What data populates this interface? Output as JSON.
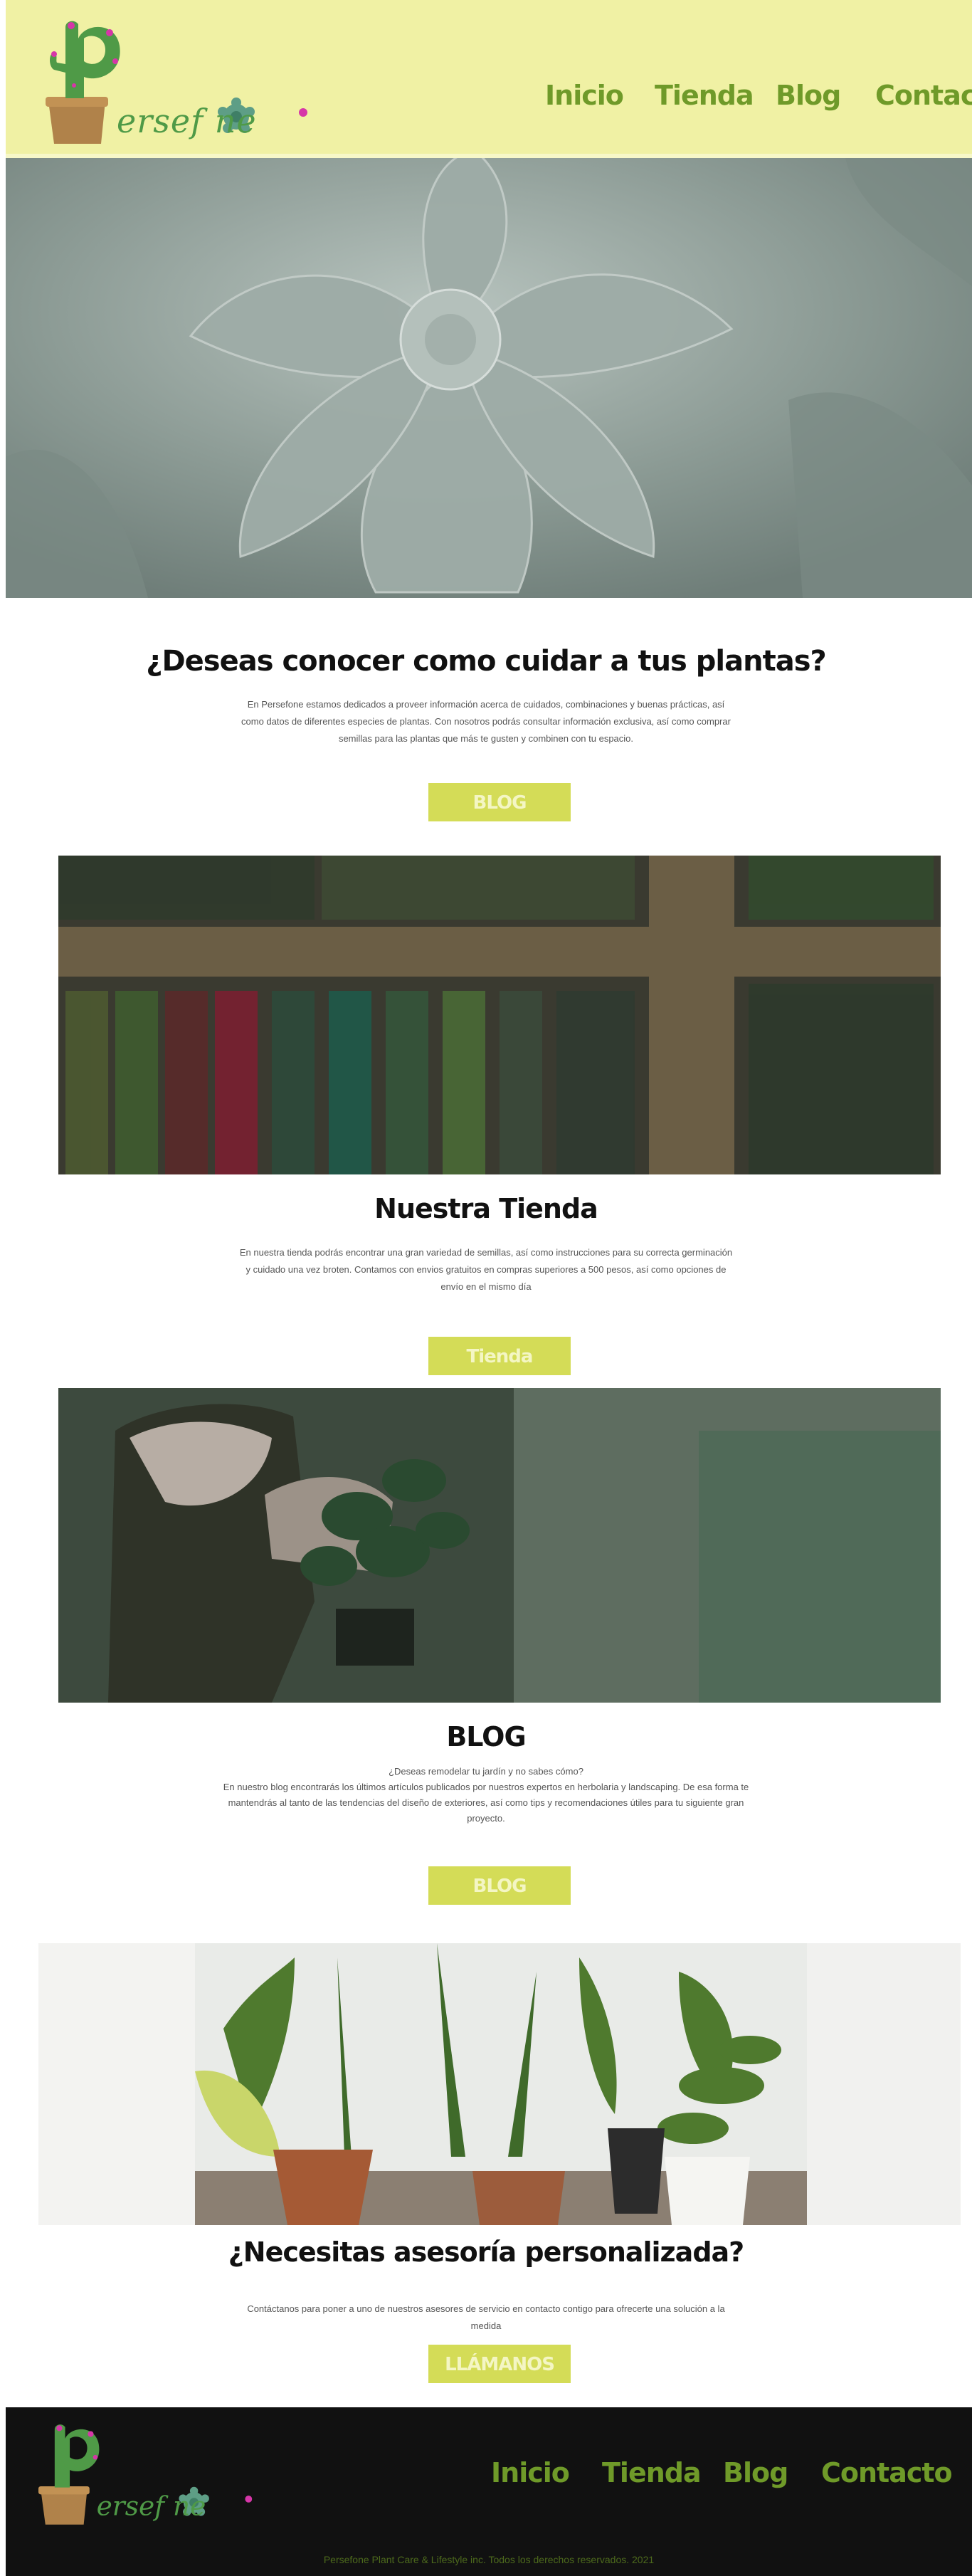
{
  "header": {
    "logo_text": "Persefone",
    "nav": [
      "Inicio",
      "Tienda",
      "Blog",
      "Contacto"
    ]
  },
  "section1": {
    "title": "¿Deseas conocer como cuidar a tus plantas?",
    "text": "En Persefone estamos dedicados a proveer información acerca de cuidados, combinaciones y buenas prácticas, así como datos de diferentes especies de plantas.  Con nosotros podrás consultar información exclusiva, así como comprar semillas para las plantas que más te gusten y combinen con tu espacio.",
    "button": "BLOG"
  },
  "section2": {
    "title": "Nuestra Tienda",
    "text": "En nuestra tienda podrás encontrar una gran variedad de semillas, así como instrucciones para su correcta germinación y cuidado una vez broten. Contamos con envios gratuitos en compras superiores a  500 pesos, así como opciones de envío en el mismo día",
    "button": "Tienda"
  },
  "section3": {
    "title": "BLOG",
    "subtitle": "¿Deseas remodelar tu jardín y no sabes cómo?",
    "text": "En nuestro blog encontrarás los últimos artículos publicados por nuestros expertos en herbolaria y landscaping. De esa forma te mantendrás al tanto de las tendencias del diseño de exteriores, así como tips y recomendaciones útiles para tu siguiente gran proyecto.",
    "button": "BLOG"
  },
  "section4": {
    "title": "¿Necesitas asesoría personalizada?",
    "text": "Contáctanos para poner a uno de nuestros asesores de servicio en  contacto contigo para ofrecerte una solución a la medida",
    "button": "LLÁMANOS"
  },
  "footer": {
    "nav": [
      "Inicio",
      "Tienda",
      "Blog",
      "Contacto"
    ],
    "copyright": "Persefone Plant Care & Lifestyle inc. Todos los derechos reservados. 2021"
  },
  "colors": {
    "header_bg": "#f0f1a4",
    "accent": "#d4dc57",
    "nav_green": "#6f9a29",
    "footer_bg": "#111111"
  }
}
